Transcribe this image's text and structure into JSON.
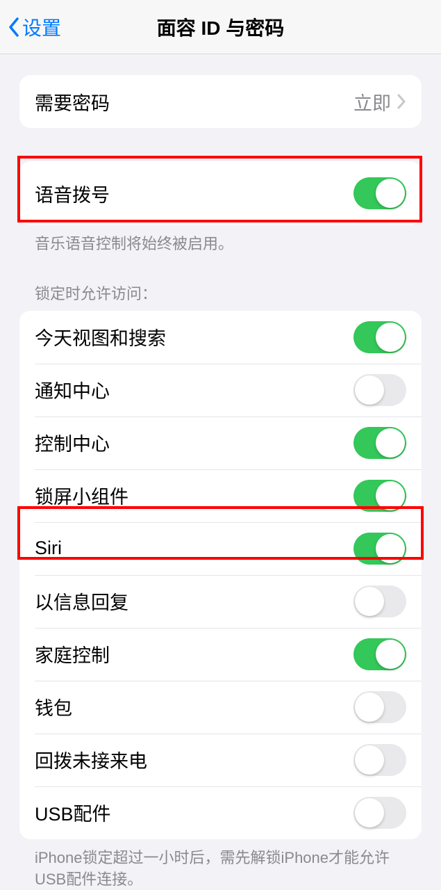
{
  "header": {
    "back_label": "设置",
    "title": "面容 ID 与密码"
  },
  "passcode_group": {
    "require_passcode": {
      "label": "需要密码",
      "value": "立即"
    }
  },
  "voice_dial_group": {
    "voice_dial": {
      "label": "语音拨号",
      "on": true
    },
    "footer": "音乐语音控制将始终被启用。"
  },
  "locked_section": {
    "header": "锁定时允许访问：",
    "items": [
      {
        "label": "今天视图和搜索",
        "on": true
      },
      {
        "label": "通知中心",
        "on": false
      },
      {
        "label": "控制中心",
        "on": true
      },
      {
        "label": "锁屏小组件",
        "on": true
      },
      {
        "label": "Siri",
        "on": true
      },
      {
        "label": "以信息回复",
        "on": false
      },
      {
        "label": "家庭控制",
        "on": true
      },
      {
        "label": "钱包",
        "on": false
      },
      {
        "label": "回拨未接来电",
        "on": false
      },
      {
        "label": "USB配件",
        "on": false
      }
    ],
    "footer": "iPhone锁定超过一小时后，需先解锁iPhone才能允许USB配件连接。"
  }
}
